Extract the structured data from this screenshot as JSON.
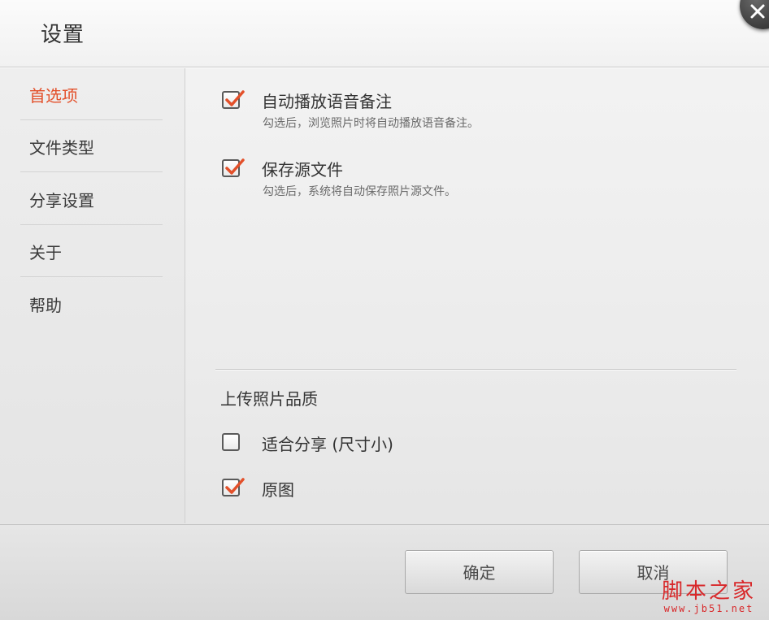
{
  "window": {
    "title": "设置"
  },
  "sidebar": {
    "items": [
      {
        "label": "首选项",
        "active": true
      },
      {
        "label": "文件类型",
        "active": false
      },
      {
        "label": "分享设置",
        "active": false
      },
      {
        "label": "关于",
        "active": false
      },
      {
        "label": "帮助",
        "active": false
      }
    ]
  },
  "preferences": {
    "options": [
      {
        "label": "自动播放语音备注",
        "description": "勾选后，浏览照片时将自动播放语音备注。",
        "checked": true
      },
      {
        "label": "保存源文件",
        "description": "勾选后，系统将自动保存照片源文件。",
        "checked": true
      }
    ],
    "upload_quality": {
      "title": "上传照片品质",
      "options": [
        {
          "label": "适合分享 (尺寸小)",
          "checked": false
        },
        {
          "label": "原图",
          "checked": true
        }
      ]
    }
  },
  "footer": {
    "ok_label": "确定",
    "cancel_label": "取消"
  },
  "watermark": {
    "main": "脚本之家",
    "sub": "www.jb51.net"
  },
  "colors": {
    "accent": "#e3502a",
    "check": "#e3502a",
    "watermark": "#d8282a"
  },
  "icons": {
    "close": "close-icon",
    "check": "checkmark-icon"
  }
}
